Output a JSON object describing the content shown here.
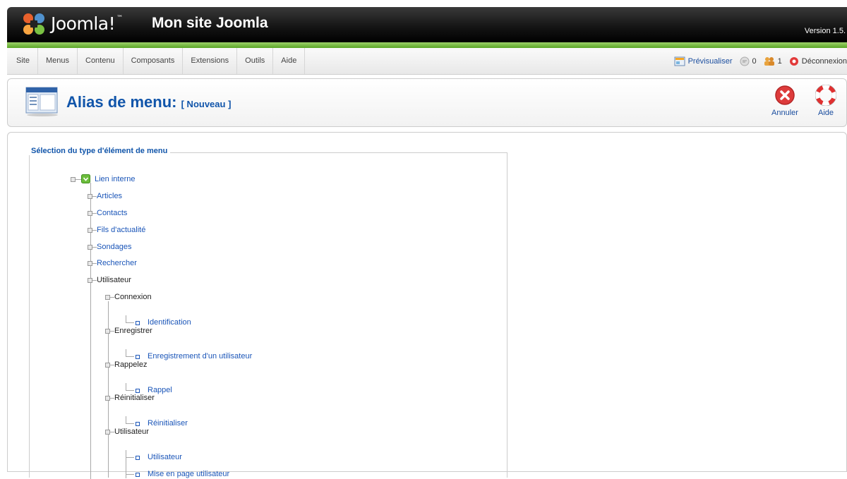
{
  "header": {
    "brand": "Joomla!",
    "site_name": "Mon site Joomla",
    "version": "Version 1.5."
  },
  "menubar": {
    "items": [
      "Site",
      "Menus",
      "Contenu",
      "Composants",
      "Extensions",
      "Outils",
      "Aide"
    ]
  },
  "status": {
    "preview": "Prévisualiser",
    "messages": "0",
    "users": "1",
    "logout": "Déconnexion"
  },
  "toolbar": {
    "title": "Alias de menu:",
    "subtitle": "[ Nouveau ]",
    "cancel": "Annuler",
    "help": "Aide"
  },
  "content": {
    "legend": "Sélection du type d'élément de menu",
    "root": "Lien interne",
    "categories": [
      "Articles",
      "Contacts",
      "Fils d'actualité",
      "Sondages",
      "Rechercher"
    ],
    "user_section": "Utilisateur",
    "user_groups": [
      {
        "label": "Connexion",
        "child": "Identification"
      },
      {
        "label": "Enregistrer",
        "child": "Enregistrement d'un utilisateur"
      },
      {
        "label": "Rappelez",
        "child": "Rappel"
      },
      {
        "label": "Réinitialiser",
        "child": "Réinitialiser"
      },
      {
        "label": "Utilisateur",
        "children": [
          "Utilisateur",
          "Mise en page utilisateur"
        ]
      }
    ]
  },
  "colors": {
    "link": "#1a55b8",
    "title": "#1155aa",
    "accent_green": "#5aa626"
  }
}
